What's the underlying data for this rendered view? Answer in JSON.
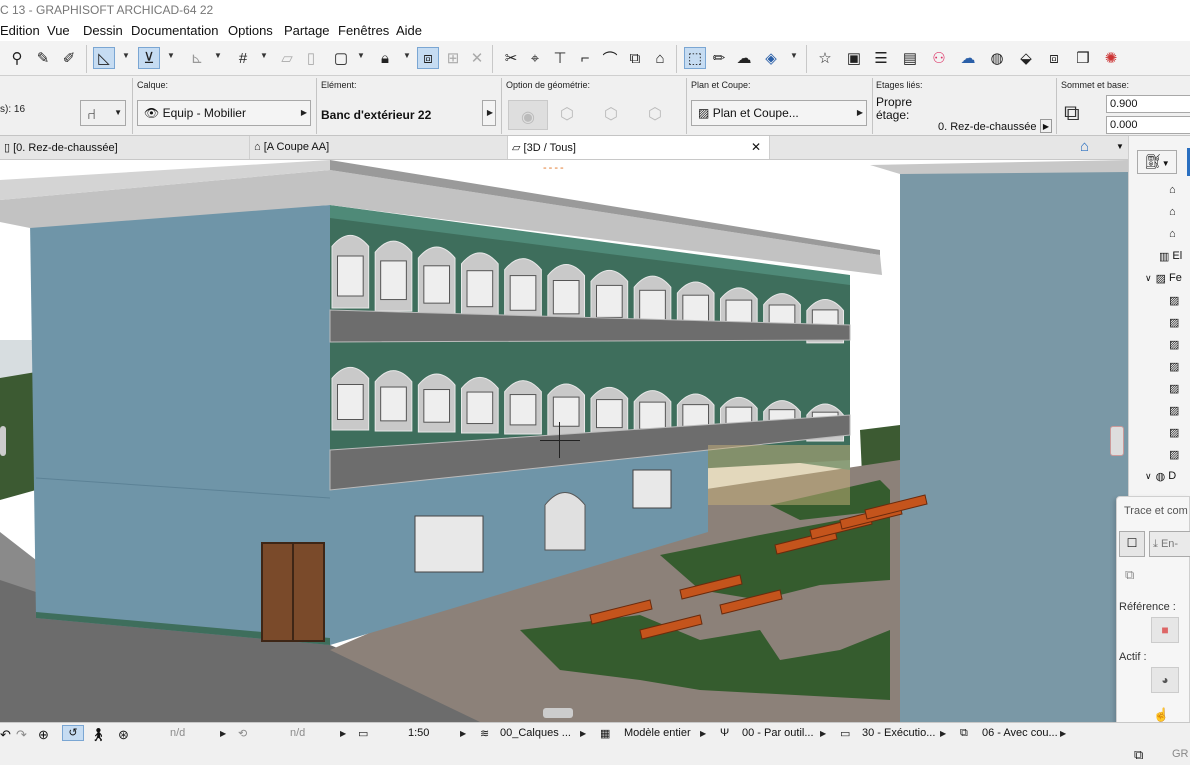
{
  "window": {
    "title": "C 13 - GRAPHISOFT ARCHICAD-64 22"
  },
  "menu": [
    "Edition",
    "Vue",
    "Dessin",
    "Documentation",
    "Options",
    "Partage",
    "Fenêtres",
    "Aide"
  ],
  "infobox": {
    "left_label": "s): 16",
    "calque_label": "Calque:",
    "calque_value": "Equip - Mobilier",
    "element_label": "Elément:",
    "element_value": "Banc d'extérieur 22",
    "geometrie_label": "Option de géométrie:",
    "plan_label": "Plan et Coupe:",
    "plan_value": "Plan et Coupe...",
    "etages_label": "Etages liés:",
    "etages_propre": "Propre",
    "etages_etage": "étage:",
    "etages_value": "0. Rez-de-chaussée",
    "sommet_label": "Sommet et base:",
    "sommet_top": "0.900",
    "sommet_base": "0.000"
  },
  "tabs": [
    {
      "label": "[0. Rez-de-chaussée]"
    },
    {
      "label": "[A Coupe AA]"
    },
    {
      "label": "[3D / Tous]"
    }
  ],
  "viewport": {
    "marker_text": "----"
  },
  "navigator": {
    "rows": [
      "El",
      "Fe",
      "D"
    ]
  },
  "trace": {
    "title": "Trace et com",
    "button": "En-",
    "reference_label": "Référence :",
    "actif_label": "Actif :"
  },
  "status": {
    "nd1": "n/d",
    "nd2": "n/d",
    "scale": "1:50",
    "layers": "00_Calques ...",
    "model": "Modèle entier",
    "pen": "00 - Par outil...",
    "exec": "30 - Exécutio...",
    "cover": "06 - Avec cou..."
  },
  "bottom": {
    "corner": "GR"
  },
  "colors": {
    "wall_blue": "#6f95a8",
    "trim_green": "#3e6e5c",
    "roof_gray": "#b8b8b8",
    "bench_orange": "#c4541c",
    "grass": "#355c2e",
    "paving": "#8c8179"
  }
}
